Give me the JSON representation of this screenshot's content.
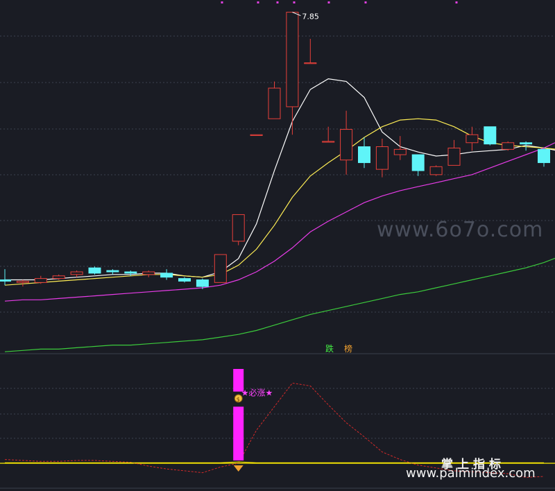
{
  "colors": {
    "background": "#1a1c24",
    "grid": "#3c4250",
    "up_candle": "#e8403a",
    "down_candle": "#5ff4f8",
    "ma_fast": "#ffffff",
    "ma_mid": "#ffee55",
    "ma_slow": "#e83ce8",
    "ma_long": "#3ccc3c",
    "signal_bar": "#ff22ff",
    "osc_line": "#ffee00",
    "osc_dashed": "#d22a2a",
    "marker_orange": "#f0a030"
  },
  "watermarks": {
    "center": "www.6o7o.com",
    "brand_cn": "掌上指标",
    "brand_url": "www.palmindex.com"
  },
  "chart_data": [
    {
      "type": "candlestick",
      "panel": "price",
      "title": "",
      "high_label": "7.85",
      "grid": true,
      "candles": [
        {
          "o": 5.84,
          "h": 5.92,
          "l": 5.8,
          "c": 5.83
        },
        {
          "o": 5.82,
          "h": 5.84,
          "l": 5.79,
          "c": 5.83
        },
        {
          "o": 5.82,
          "h": 5.87,
          "l": 5.81,
          "c": 5.85
        },
        {
          "o": 5.85,
          "h": 5.88,
          "l": 5.84,
          "c": 5.87
        },
        {
          "o": 5.88,
          "h": 5.91,
          "l": 5.86,
          "c": 5.9
        },
        {
          "o": 5.93,
          "h": 5.94,
          "l": 5.88,
          "c": 5.89
        },
        {
          "o": 5.91,
          "h": 5.92,
          "l": 5.88,
          "c": 5.9
        },
        {
          "o": 5.9,
          "h": 5.91,
          "l": 5.87,
          "c": 5.89
        },
        {
          "o": 5.88,
          "h": 5.91,
          "l": 5.86,
          "c": 5.9
        },
        {
          "o": 5.89,
          "h": 5.92,
          "l": 5.84,
          "c": 5.86
        },
        {
          "o": 5.85,
          "h": 5.86,
          "l": 5.82,
          "c": 5.83
        },
        {
          "o": 5.84,
          "h": 5.85,
          "l": 5.77,
          "c": 5.79
        },
        {
          "o": 5.82,
          "h": 6.03,
          "l": 5.82,
          "c": 6.03
        },
        {
          "o": 6.13,
          "h": 6.33,
          "l": 6.1,
          "c": 6.33
        },
        {
          "o": 6.93,
          "h": 6.93,
          "l": 6.93,
          "c": 6.93
        },
        {
          "o": 7.05,
          "h": 7.33,
          "l": 7.05,
          "c": 7.28
        },
        {
          "o": 7.14,
          "h": 7.85,
          "l": 6.93,
          "c": 7.85
        },
        {
          "o": 7.47,
          "h": 7.65,
          "l": 7.47,
          "c": 7.47
        },
        {
          "o": 6.88,
          "h": 6.99,
          "l": 6.88,
          "c": 6.88
        },
        {
          "o": 6.74,
          "h": 7.11,
          "l": 6.63,
          "c": 6.97
        },
        {
          "o": 6.84,
          "h": 6.91,
          "l": 6.68,
          "c": 6.72
        },
        {
          "o": 6.67,
          "h": 6.9,
          "l": 6.61,
          "c": 6.84
        },
        {
          "o": 6.78,
          "h": 6.92,
          "l": 6.74,
          "c": 6.82
        },
        {
          "o": 6.78,
          "h": 6.78,
          "l": 6.62,
          "c": 6.66
        },
        {
          "o": 6.63,
          "h": 6.7,
          "l": 6.62,
          "c": 6.69
        },
        {
          "o": 6.7,
          "h": 6.89,
          "l": 6.7,
          "c": 6.83
        },
        {
          "o": 6.87,
          "h": 6.99,
          "l": 6.81,
          "c": 6.93
        },
        {
          "o": 6.99,
          "h": 6.99,
          "l": 6.85,
          "c": 6.86
        },
        {
          "o": 6.82,
          "h": 6.88,
          "l": 6.81,
          "c": 6.87
        },
        {
          "o": 6.87,
          "h": 6.88,
          "l": 6.81,
          "c": 6.86
        },
        {
          "o": 6.82,
          "h": 6.83,
          "l": 6.69,
          "c": 6.72
        }
      ],
      "ylim": [
        5.4,
        7.9
      ],
      "ma_series": [
        {
          "key": "ma_fast",
          "values": [
            5.84,
            5.84,
            5.84,
            5.85,
            5.86,
            5.87,
            5.88,
            5.88,
            5.89,
            5.89,
            5.87,
            5.86,
            5.9,
            6.0,
            6.26,
            6.66,
            7.03,
            7.27,
            7.35,
            7.33,
            7.21,
            6.95,
            6.84,
            6.8,
            6.77,
            6.78,
            6.8,
            6.81,
            6.82,
            6.85,
            6.83
          ]
        },
        {
          "key": "ma_mid",
          "values": [
            5.8,
            5.81,
            5.82,
            5.83,
            5.84,
            5.85,
            5.86,
            5.87,
            5.88,
            5.88,
            5.87,
            5.86,
            5.88,
            5.95,
            6.07,
            6.25,
            6.46,
            6.62,
            6.72,
            6.81,
            6.91,
            6.99,
            7.04,
            7.05,
            7.04,
            6.99,
            6.92,
            6.87,
            6.85,
            6.84,
            6.83
          ]
        },
        {
          "key": "ma_slow",
          "values": [
            5.68,
            5.69,
            5.69,
            5.7,
            5.71,
            5.72,
            5.73,
            5.74,
            5.75,
            5.76,
            5.77,
            5.78,
            5.8,
            5.84,
            5.9,
            5.98,
            6.08,
            6.2,
            6.28,
            6.35,
            6.42,
            6.47,
            6.51,
            6.54,
            6.57,
            6.6,
            6.63,
            6.68,
            6.73,
            6.78,
            6.83
          ]
        },
        {
          "key": "ma_long",
          "values": [
            5.3,
            5.31,
            5.32,
            5.32,
            5.33,
            5.34,
            5.35,
            5.35,
            5.36,
            5.37,
            5.38,
            5.39,
            5.41,
            5.43,
            5.46,
            5.5,
            5.54,
            5.58,
            5.61,
            5.64,
            5.67,
            5.7,
            5.73,
            5.75,
            5.78,
            5.81,
            5.84,
            5.87,
            5.9,
            5.93,
            5.97
          ]
        }
      ]
    },
    {
      "type": "indicator",
      "panel": "oscillator",
      "header_labels": [
        {
          "text": "跌",
          "color": "#44ee44"
        },
        {
          "text": "榜",
          "color": "#f0a030"
        }
      ],
      "signal_label": "★必涨★",
      "signal_index": 13,
      "ylim": [
        0,
        100
      ],
      "bar_bottom": 3,
      "bar_top": 100,
      "bar_gap": [
        60,
        76
      ],
      "baseline": 0,
      "dashed_values": [
        4,
        3,
        2,
        2,
        3,
        3,
        2,
        1,
        -3,
        -6,
        -8,
        -10,
        -4,
        0,
        35,
        60,
        85,
        82,
        62,
        43,
        28,
        12,
        4,
        -2,
        -5,
        -8,
        -9,
        -10,
        -11,
        -15,
        -14
      ],
      "solid_values": [
        0.5,
        0.5,
        0.5,
        0.5,
        0.5,
        0.5,
        0.5,
        0.5,
        0.5,
        0.5,
        0.5,
        0.5,
        0.5,
        1.5,
        0.5,
        0.5,
        0.5,
        0.5,
        0.5,
        0.5,
        0.5,
        0.5,
        0.5,
        0.5,
        0.5,
        0.5,
        0.5,
        0.5,
        0.5,
        0.5,
        0.5
      ]
    }
  ]
}
